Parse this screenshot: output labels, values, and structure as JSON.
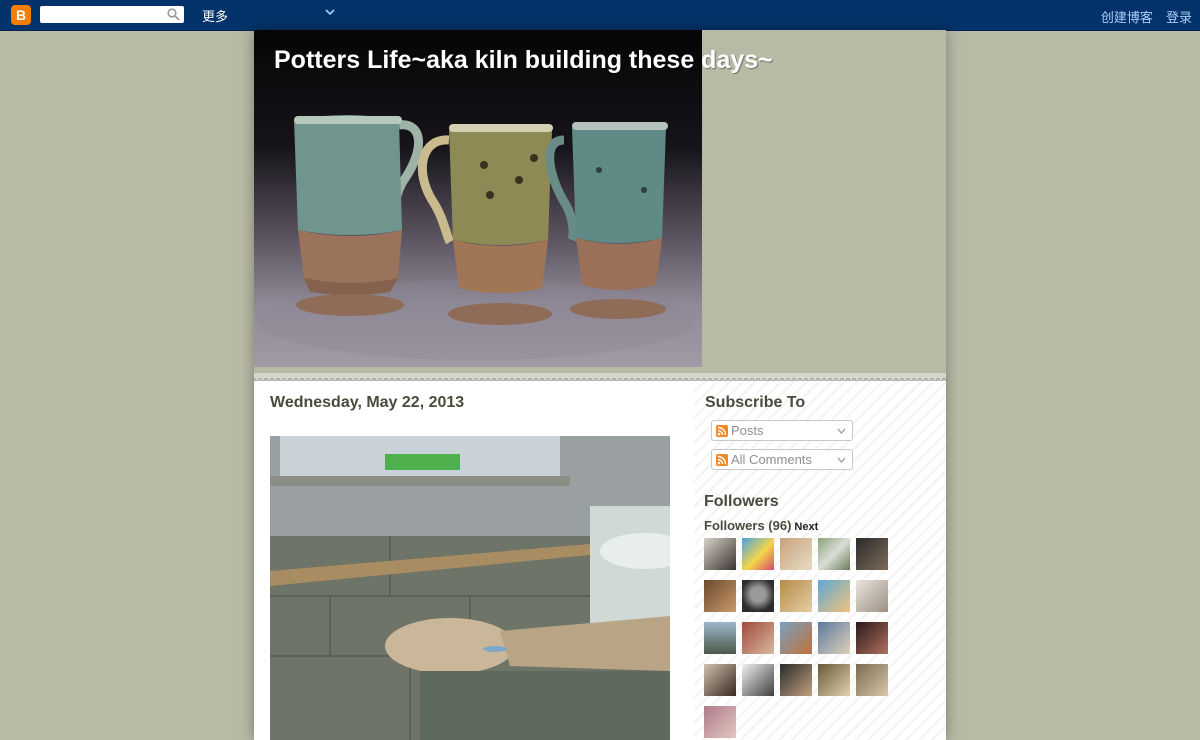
{
  "navbar": {
    "logo": "B",
    "more_label": "更多",
    "create_blog": "创建博客",
    "login": "登录"
  },
  "blog": {
    "title": "Potters Life~aka kiln building these days~"
  },
  "post": {
    "date": "Wednesday, May 22, 2013"
  },
  "sidebar": {
    "subscribe": {
      "title": "Subscribe To",
      "options": [
        "Posts",
        "All Comments"
      ]
    },
    "followers": {
      "title": "Followers",
      "count_label": "Followers (96)",
      "next_label": "Next"
    }
  },
  "colors": {
    "navbar": "#03336a",
    "page_background": "#b9baa6",
    "heading_text": "#4b4a3c",
    "nav_link": "#a9cdfa",
    "blogger_orange": "#f57d00"
  },
  "icons": [
    "blogger-logo-icon",
    "search-icon",
    "chevron-down-icon",
    "rss-icon"
  ]
}
